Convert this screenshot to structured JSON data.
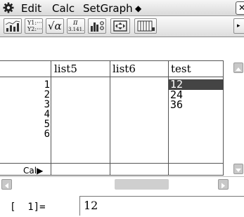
{
  "menubar": {
    "gear_icon": "gear-icon",
    "items": [
      "Edit",
      "Calc",
      "SetGraph"
    ],
    "dropdown_marker": "◆",
    "close_label": "✕"
  },
  "toolbar": {
    "buttons": [
      {
        "name": "graph-icon"
      },
      {
        "name": "y-equation-icon",
        "line1": "Y1:···",
        "line2": "Y2:···"
      },
      {
        "name": "sqrt-alpha-icon",
        "text": "√α"
      },
      {
        "name": "pi-value-icon",
        "line1": "π",
        "line2": "3.141.."
      },
      {
        "name": "stat-graph-icon"
      },
      {
        "name": "resize-icon"
      },
      {
        "name": "sheet-columns-icon"
      }
    ],
    "more_marker": "▸"
  },
  "sheet": {
    "columns": [
      "list5",
      "list6",
      "test"
    ],
    "row_numbers": [
      "1",
      "2",
      "3",
      "4",
      "5",
      "6"
    ],
    "test_values": [
      "12",
      "24",
      "36"
    ],
    "selected_row": 0,
    "calc_label": "Cal▶"
  },
  "editline": {
    "cell_ref": "[  1]=",
    "value": "12"
  },
  "colors": {
    "selection": "#444444",
    "toolbar_bg": "#e3e3e3"
  }
}
